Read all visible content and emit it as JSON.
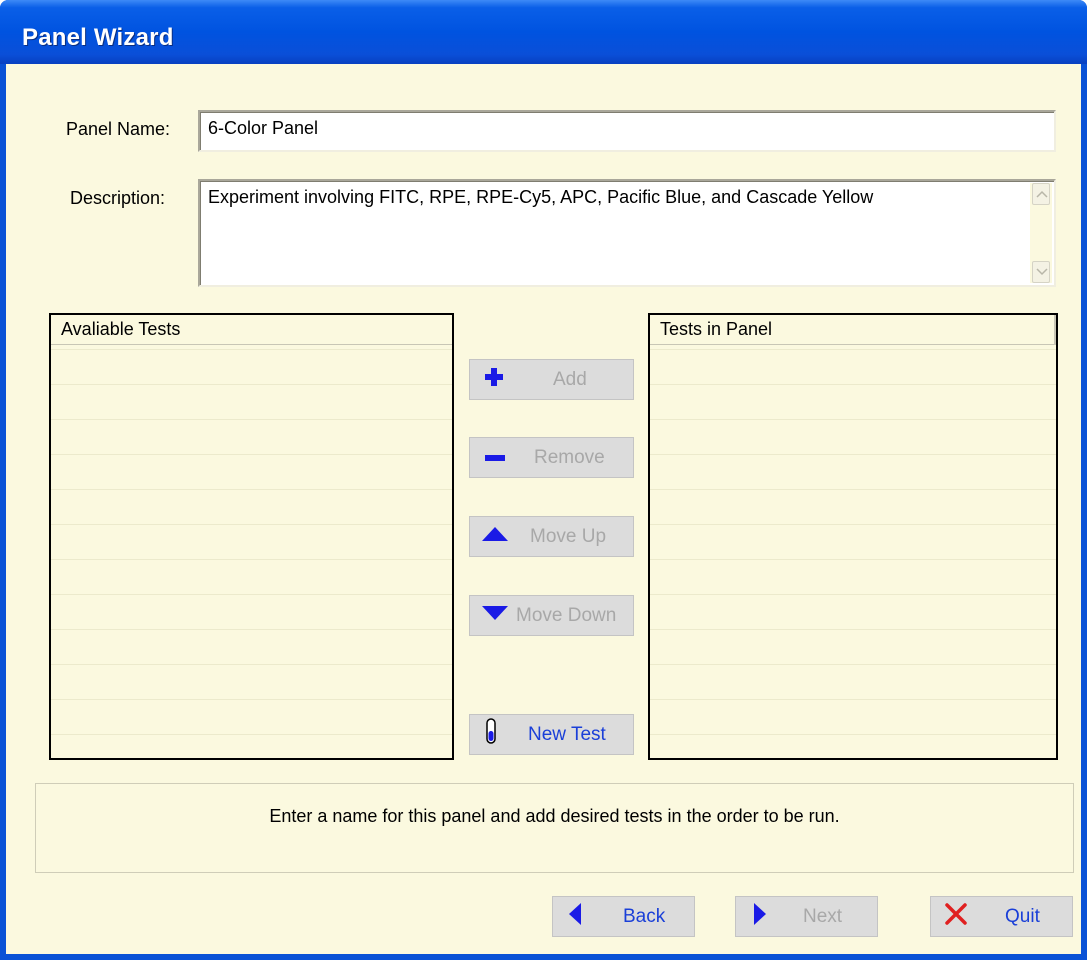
{
  "window": {
    "title": "Panel Wizard"
  },
  "form": {
    "panel_name_label": "Panel Name:",
    "panel_name_value": "6-Color Panel",
    "description_label": "Description:",
    "description_value": "Experiment involving FITC, RPE, RPE-Cy5, APC, Pacific Blue, and Cascade Yellow"
  },
  "available_tests": {
    "header": "Avaliable Tests",
    "items": []
  },
  "tests_in_panel": {
    "header": "Tests in Panel",
    "items": []
  },
  "actions": {
    "add": "Add",
    "remove": "Remove",
    "move_up": "Move Up",
    "move_down": "Move Down",
    "new_test": "New Test"
  },
  "status": {
    "message": "Enter a name for this panel and add desired tests in the order to be run."
  },
  "nav": {
    "back": "Back",
    "next": "Next",
    "quit": "Quit"
  },
  "colors": {
    "title_bar": "#0053e0",
    "client_bg": "#fbf9df",
    "icon_blue": "#1a1ae6",
    "quit_red": "#e02020"
  }
}
